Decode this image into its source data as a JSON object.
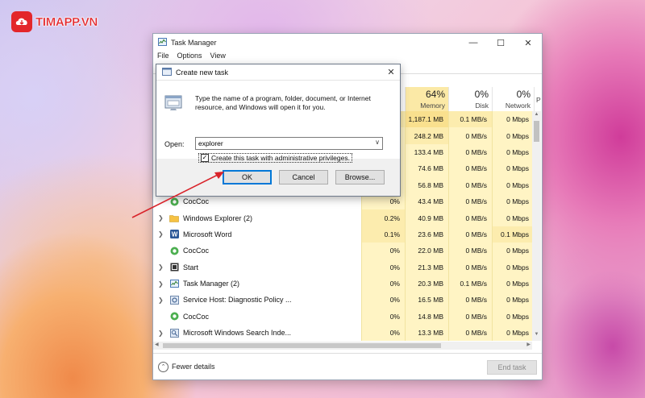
{
  "logo": {
    "text": "TIMAPP.VN"
  },
  "window": {
    "title": "Task Manager",
    "menu": [
      "File",
      "Options",
      "View"
    ],
    "controls": [
      "minimize",
      "maximize",
      "close"
    ]
  },
  "columns": [
    {
      "pct": "64%",
      "label": "Memory"
    },
    {
      "pct": "0%",
      "label": "Disk"
    },
    {
      "pct": "0%",
      "label": "Network"
    },
    {
      "pct": "",
      "label": "P"
    }
  ],
  "processes_top_hidden": [
    {
      "memory": "1,187.1 MB",
      "disk": "0.1 MB/s",
      "network": "0 Mbps"
    },
    {
      "memory": "248.2 MB",
      "disk": "0 MB/s",
      "network": "0 Mbps"
    },
    {
      "memory": "133.4 MB",
      "disk": "0 MB/s",
      "network": "0 Mbps"
    },
    {
      "memory": "74.6 MB",
      "disk": "0 MB/s",
      "network": "0 Mbps"
    },
    {
      "memory": "56.8 MB",
      "disk": "0 MB/s",
      "network": "0 Mbps"
    }
  ],
  "processes": [
    {
      "name": "CocCoc",
      "icon": "coccoc-icon",
      "expand": false,
      "cpu": "0%",
      "memory": "43.4 MB",
      "disk": "0 MB/s",
      "network": "0 Mbps"
    },
    {
      "name": "Windows Explorer (2)",
      "icon": "folder-icon",
      "expand": true,
      "cpu": "0.2%",
      "memory": "40.9 MB",
      "disk": "0 MB/s",
      "network": "0 Mbps"
    },
    {
      "name": "Microsoft Word",
      "icon": "word-icon",
      "expand": true,
      "cpu": "0.1%",
      "memory": "23.6 MB",
      "disk": "0 MB/s",
      "network": "0.1 Mbps"
    },
    {
      "name": "CocCoc",
      "icon": "coccoc-icon",
      "expand": false,
      "cpu": "0%",
      "memory": "22.0 MB",
      "disk": "0 MB/s",
      "network": "0 Mbps"
    },
    {
      "name": "Start",
      "icon": "start-icon",
      "expand": true,
      "cpu": "0%",
      "memory": "21.3 MB",
      "disk": "0 MB/s",
      "network": "0 Mbps"
    },
    {
      "name": "Task Manager (2)",
      "icon": "task-manager-icon",
      "expand": true,
      "cpu": "0%",
      "memory": "20.3 MB",
      "disk": "0.1 MB/s",
      "network": "0 Mbps"
    },
    {
      "name": "Service Host: Diagnostic Policy ...",
      "icon": "service-host-icon",
      "expand": true,
      "cpu": "0%",
      "memory": "16.5 MB",
      "disk": "0 MB/s",
      "network": "0 Mbps"
    },
    {
      "name": "CocCoc",
      "icon": "coccoc-icon",
      "expand": false,
      "cpu": "0%",
      "memory": "14.8 MB",
      "disk": "0 MB/s",
      "network": "0 Mbps"
    },
    {
      "name": "Microsoft Windows Search Inde...",
      "icon": "search-indexer-icon",
      "expand": true,
      "cpu": "0%",
      "memory": "13.3 MB",
      "disk": "0 MB/s",
      "network": "0 Mbps"
    }
  ],
  "footer": {
    "fewer_details": "Fewer details",
    "end_task": "End task"
  },
  "dialog": {
    "title": "Create new task",
    "description": "Type the name of a program, folder, document, or Internet resource, and Windows will open it for you.",
    "open_label": "Open:",
    "open_value": "explorer",
    "admin_checkbox": "Create this task with administrative privileges.",
    "admin_checked": true,
    "ok": "OK",
    "cancel": "Cancel",
    "browse": "Browse..."
  },
  "colors": {
    "heat_light": "#fff4c4",
    "heat_mid": "#fcecae",
    "heat_strong": "#f9e08e",
    "focus_blue": "#0078d7",
    "annotation_red": "#d9232a"
  }
}
